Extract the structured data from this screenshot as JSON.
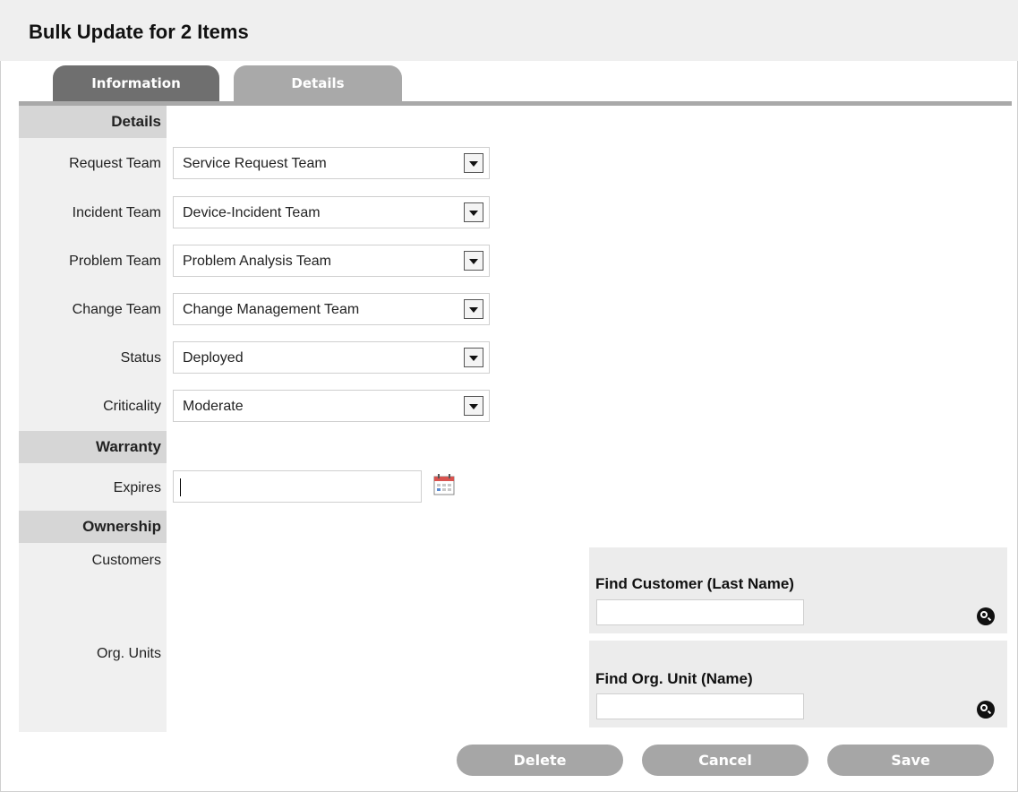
{
  "header": {
    "title": "Bulk Update for 2 Items"
  },
  "tabs": [
    {
      "label": "Information",
      "active": true
    },
    {
      "label": "Details",
      "active": false
    }
  ],
  "sections": {
    "details": "Details",
    "warranty": "Warranty",
    "ownership": "Ownership"
  },
  "fields": {
    "request_team": {
      "label": "Request Team",
      "value": "Service Request Team"
    },
    "incident_team": {
      "label": "Incident Team",
      "value": "Device-Incident Team"
    },
    "problem_team": {
      "label": "Problem Team",
      "value": "Problem Analysis Team"
    },
    "change_team": {
      "label": "Change Team",
      "value": "Change Management Team"
    },
    "status": {
      "label": "Status",
      "value": "Deployed"
    },
    "criticality": {
      "label": "Criticality",
      "value": "Moderate"
    },
    "expires": {
      "label": "Expires",
      "value": ""
    },
    "customers": {
      "label": "Customers"
    },
    "org_units": {
      "label": "Org. Units"
    }
  },
  "search": {
    "customer": {
      "label": "Find Customer (Last Name)",
      "value": ""
    },
    "org_unit": {
      "label": "Find Org. Unit (Name)",
      "value": ""
    }
  },
  "buttons": {
    "delete": "Delete",
    "cancel": "Cancel",
    "save": "Save"
  },
  "icons": {
    "calendar": "calendar-icon",
    "search": "magnifier-icon"
  },
  "colors": {
    "tab_active": "#6f6f6f",
    "tab_inactive": "#a9a9a9",
    "button": "#a6a6a6",
    "section_header": "#d6d6d6"
  }
}
